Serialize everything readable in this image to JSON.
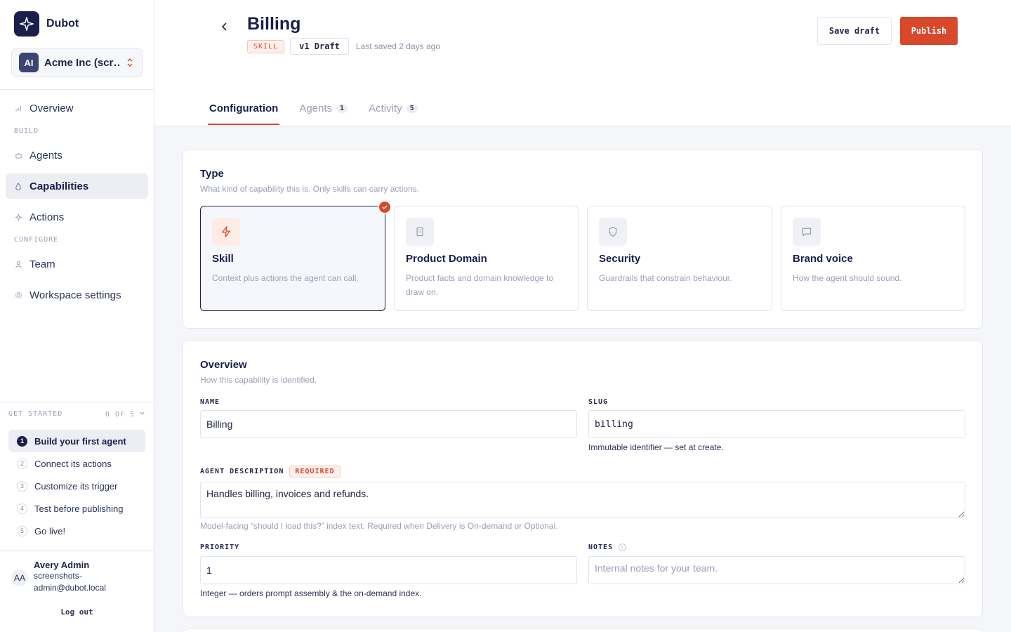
{
  "app": {
    "name": "Dubot"
  },
  "org": {
    "initials": "AI",
    "name": "Acme Inc (scr…"
  },
  "nav": {
    "overview": "Overview",
    "section_build": "BUILD",
    "agents": "Agents",
    "capabilities": "Capabilities",
    "actions": "Actions",
    "section_configure": "CONFIGURE",
    "team": "Team",
    "workspace_settings": "Workspace settings"
  },
  "get_started": {
    "title": "GET STARTED",
    "progress": "0 OF 5",
    "steps": [
      {
        "num": "1",
        "label": "Build your first agent"
      },
      {
        "num": "2",
        "label": "Connect its actions"
      },
      {
        "num": "3",
        "label": "Customize its trigger"
      },
      {
        "num": "4",
        "label": "Test before publishing"
      },
      {
        "num": "5",
        "label": "Go live!"
      }
    ]
  },
  "user": {
    "initials": "AA",
    "name": "Avery Admin",
    "email_line1": "screenshots-",
    "email_line2": "admin@dubot.local",
    "logout": "Log out"
  },
  "header": {
    "title": "Billing",
    "kind_badge": "SKILL",
    "version_badge": "v1 Draft",
    "last_saved": "Last saved 2 days ago",
    "save_draft": "Save draft",
    "publish": "Publish"
  },
  "tabs": [
    {
      "label": "Configuration",
      "count": ""
    },
    {
      "label": "Agents",
      "count": "1"
    },
    {
      "label": "Activity",
      "count": "5"
    }
  ],
  "type_card": {
    "title": "Type",
    "subtitle": "What kind of capability this is. Only skills can carry actions.",
    "options": [
      {
        "name": "Skill",
        "desc": "Context plus actions the agent can call.",
        "icon": "lightning-icon",
        "selected": true
      },
      {
        "name": "Product Domain",
        "desc": "Product facts and domain knowledge to draw on.",
        "icon": "building-icon",
        "selected": false
      },
      {
        "name": "Security",
        "desc": "Guardrails that constrain behaviour.",
        "icon": "shield-icon",
        "selected": false
      },
      {
        "name": "Brand voice",
        "desc": "How the agent should sound.",
        "icon": "chat-bubble-icon",
        "selected": false
      }
    ]
  },
  "overview_card": {
    "title": "Overview",
    "subtitle": "How this capability is identified.",
    "name_label": "NAME",
    "name_value": "Billing",
    "slug_label": "SLUG",
    "slug_value": "billing",
    "slug_help": "Immutable identifier — set at create.",
    "desc_label": "AGENT DESCRIPTION",
    "required": "REQUIRED",
    "desc_value": "Handles billing, invoices and refunds.",
    "desc_help": "Model-facing “should I load this?” index text. Required when Delivery is On-demand or Optional.",
    "priority_label": "PRIORITY",
    "priority_value": "1",
    "priority_help": "Integer — orders prompt assembly & the on-demand index.",
    "notes_label": "NOTES",
    "notes_placeholder": "Internal notes for your team."
  },
  "colors": {
    "accent": "#d8482a",
    "navy": "#1a1f4a",
    "muted": "#9aa0b8"
  }
}
